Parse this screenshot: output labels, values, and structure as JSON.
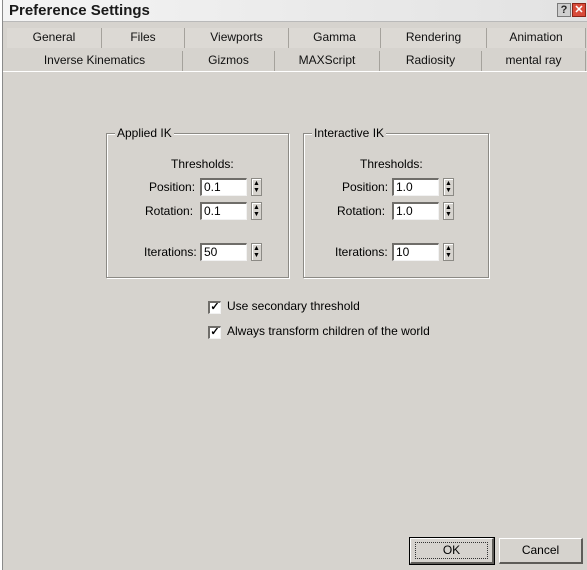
{
  "window": {
    "title": "Preference Settings",
    "help_glyph": "?",
    "close_glyph": "✕"
  },
  "tabs": {
    "row1": [
      "General",
      "Files",
      "Viewports",
      "Gamma",
      "Rendering",
      "Animation"
    ],
    "row2": [
      "Inverse Kinematics",
      "Gizmos",
      "MAXScript",
      "Radiosity",
      "mental ray"
    ],
    "active": "Inverse Kinematics"
  },
  "applied_ik": {
    "title": "Applied IK",
    "thresholds_label": "Thresholds:",
    "position_label": "Position:",
    "position_value": "0.1",
    "rotation_label": "Rotation:",
    "rotation_value": "0.1",
    "iterations_label": "Iterations:",
    "iterations_value": "50"
  },
  "interactive_ik": {
    "title": "Interactive IK",
    "thresholds_label": "Thresholds:",
    "position_label": "Position:",
    "position_value": "1.0",
    "rotation_label": "Rotation:",
    "rotation_value": "1.0",
    "iterations_label": "Iterations:",
    "iterations_value": "10"
  },
  "options": {
    "secondary_threshold": {
      "label": "Use secondary threshold",
      "checked": true
    },
    "transform_children": {
      "label": "Always transform children of the world",
      "checked": true
    }
  },
  "spinner": {
    "up": "▲",
    "down": "▼"
  },
  "checkmark": "✓",
  "buttons": {
    "ok": "OK",
    "cancel": "Cancel"
  }
}
